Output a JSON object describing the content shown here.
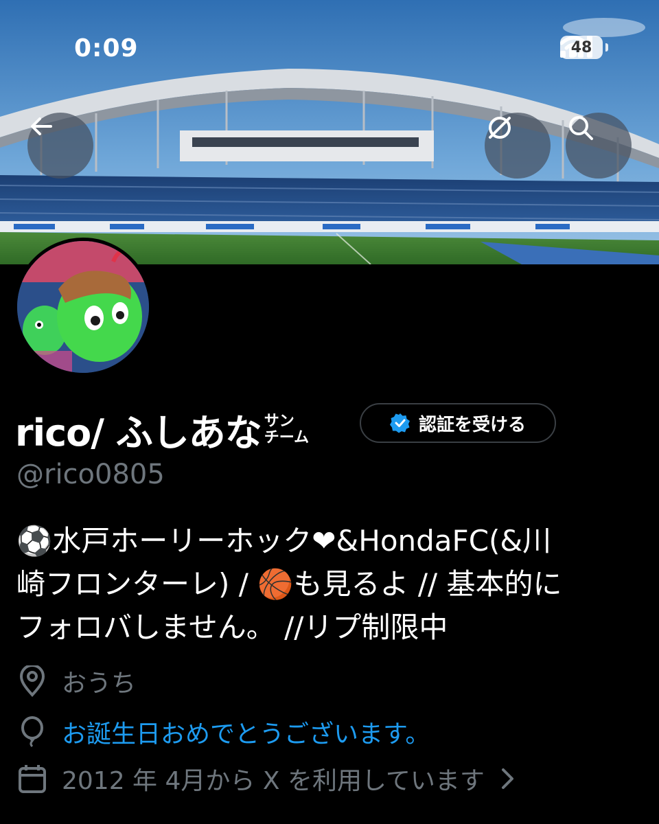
{
  "status_bar": {
    "time": "0:09",
    "battery": "48"
  },
  "banner": {
    "description_icons": [
      "back-arrow-icon",
      "hide-icon",
      "search-icon"
    ]
  },
  "profile": {
    "display_name": "rico/ ふしあな",
    "name_suffix_top": "サン",
    "name_suffix_bottom": "チーム",
    "verify_button_label": "認証を受ける",
    "handle": "@rico0805",
    "bio_lines": [
      "⚽水戸ホーリーホック❤&HondaFC(&川",
      "崎フロンターレ) / 🏀も見るよ // 基本的に",
      "フォロバしません。 //リプ制限中"
    ],
    "location": "おうち",
    "birthday": "お誕生日おめでとうございます。",
    "joined": "2012 年 4月から X を利用しています"
  },
  "colors": {
    "accent": "#1d9bf0",
    "muted": "#6e767d",
    "background": "#000000"
  }
}
